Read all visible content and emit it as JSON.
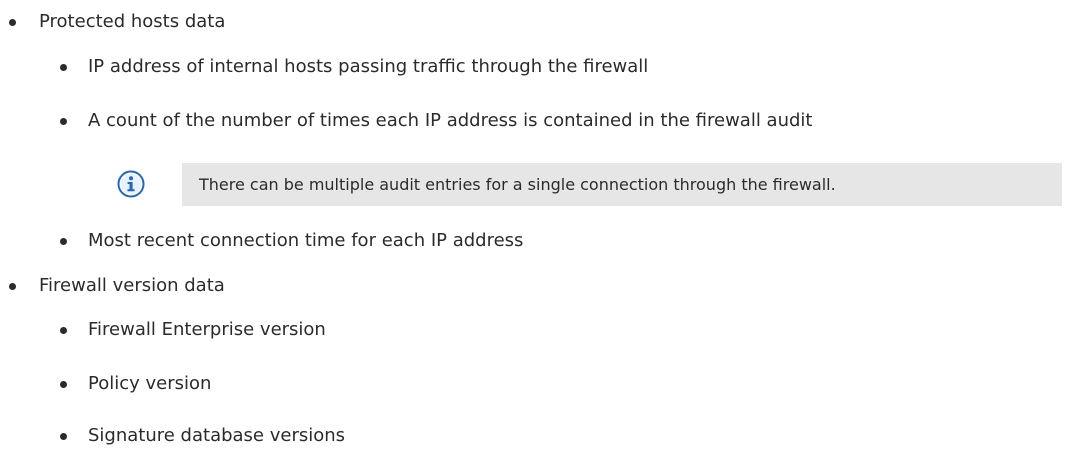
{
  "list": {
    "protected_hosts": {
      "label": "Protected hosts data",
      "items": [
        "IP address of internal hosts passing traffic through the firewall",
        "A count of the number of times each IP address is contained in the firewall audit",
        "Most recent connection time for each IP address"
      ],
      "note": {
        "icon": "info-icon",
        "text": "There can be multiple audit entries for a single connection through the firewall."
      }
    },
    "firewall_version": {
      "label": "Firewall version data",
      "items": [
        "Firewall Enterprise version",
        "Policy version",
        "Signature database versions"
      ]
    }
  },
  "colors": {
    "text": "#2b2b2b",
    "note_background": "#e6e6e6",
    "icon_blue": "#1f67c7"
  }
}
